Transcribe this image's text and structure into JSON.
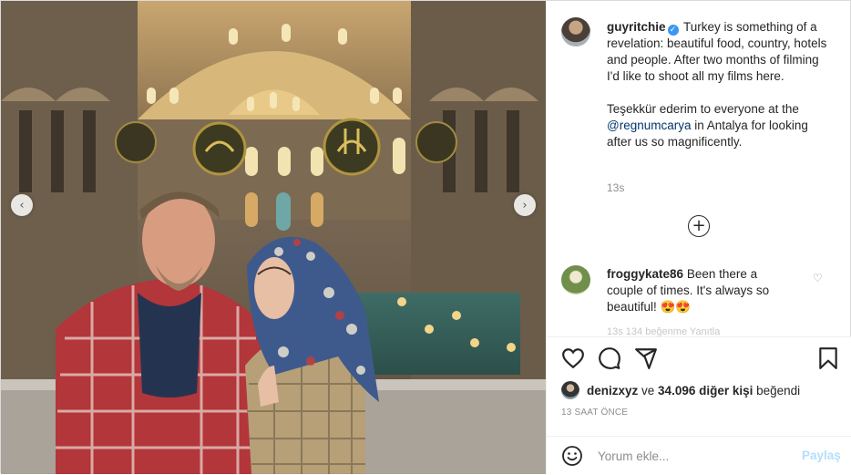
{
  "photo": {
    "alt_icon_prev": "chevron-left-icon",
    "alt_icon_next": "chevron-right-icon",
    "prev_glyph": "‹",
    "next_glyph": "›"
  },
  "caption": {
    "username": "guyritchie",
    "verified_glyph": "✓",
    "para1": "Turkey is something of a revelation: beautiful food, country, hotels and people. After two months of filming I'd like to shoot all my films here.",
    "para2_before": "Teşekkür ederim to everyone at the ",
    "para2_mention": "@regnumcarya",
    "para2_after": " in Antalya for looking after us so magnificently.",
    "time": "13s"
  },
  "load_more_glyph": "+",
  "comment": {
    "username": "froggykate86",
    "text": "Been there a couple of times. It's always so beautiful! 😍😍",
    "heart_glyph": "♡",
    "cut_text": "13s   134 beğenme   Yanıtla"
  },
  "likes": {
    "user": "denizxyz",
    "middle": " ve ",
    "count": "34.096 diğer kişi",
    "suffix": " beğendi"
  },
  "date": "13 SAAT ÖNCE",
  "comment_input": {
    "placeholder": "Yorum ekle...",
    "post_label": "Paylaş"
  },
  "colors": {
    "link": "#00376b",
    "verified": "#3897f0",
    "post_button": "#b2dffc",
    "muted": "#8e8e8e"
  }
}
